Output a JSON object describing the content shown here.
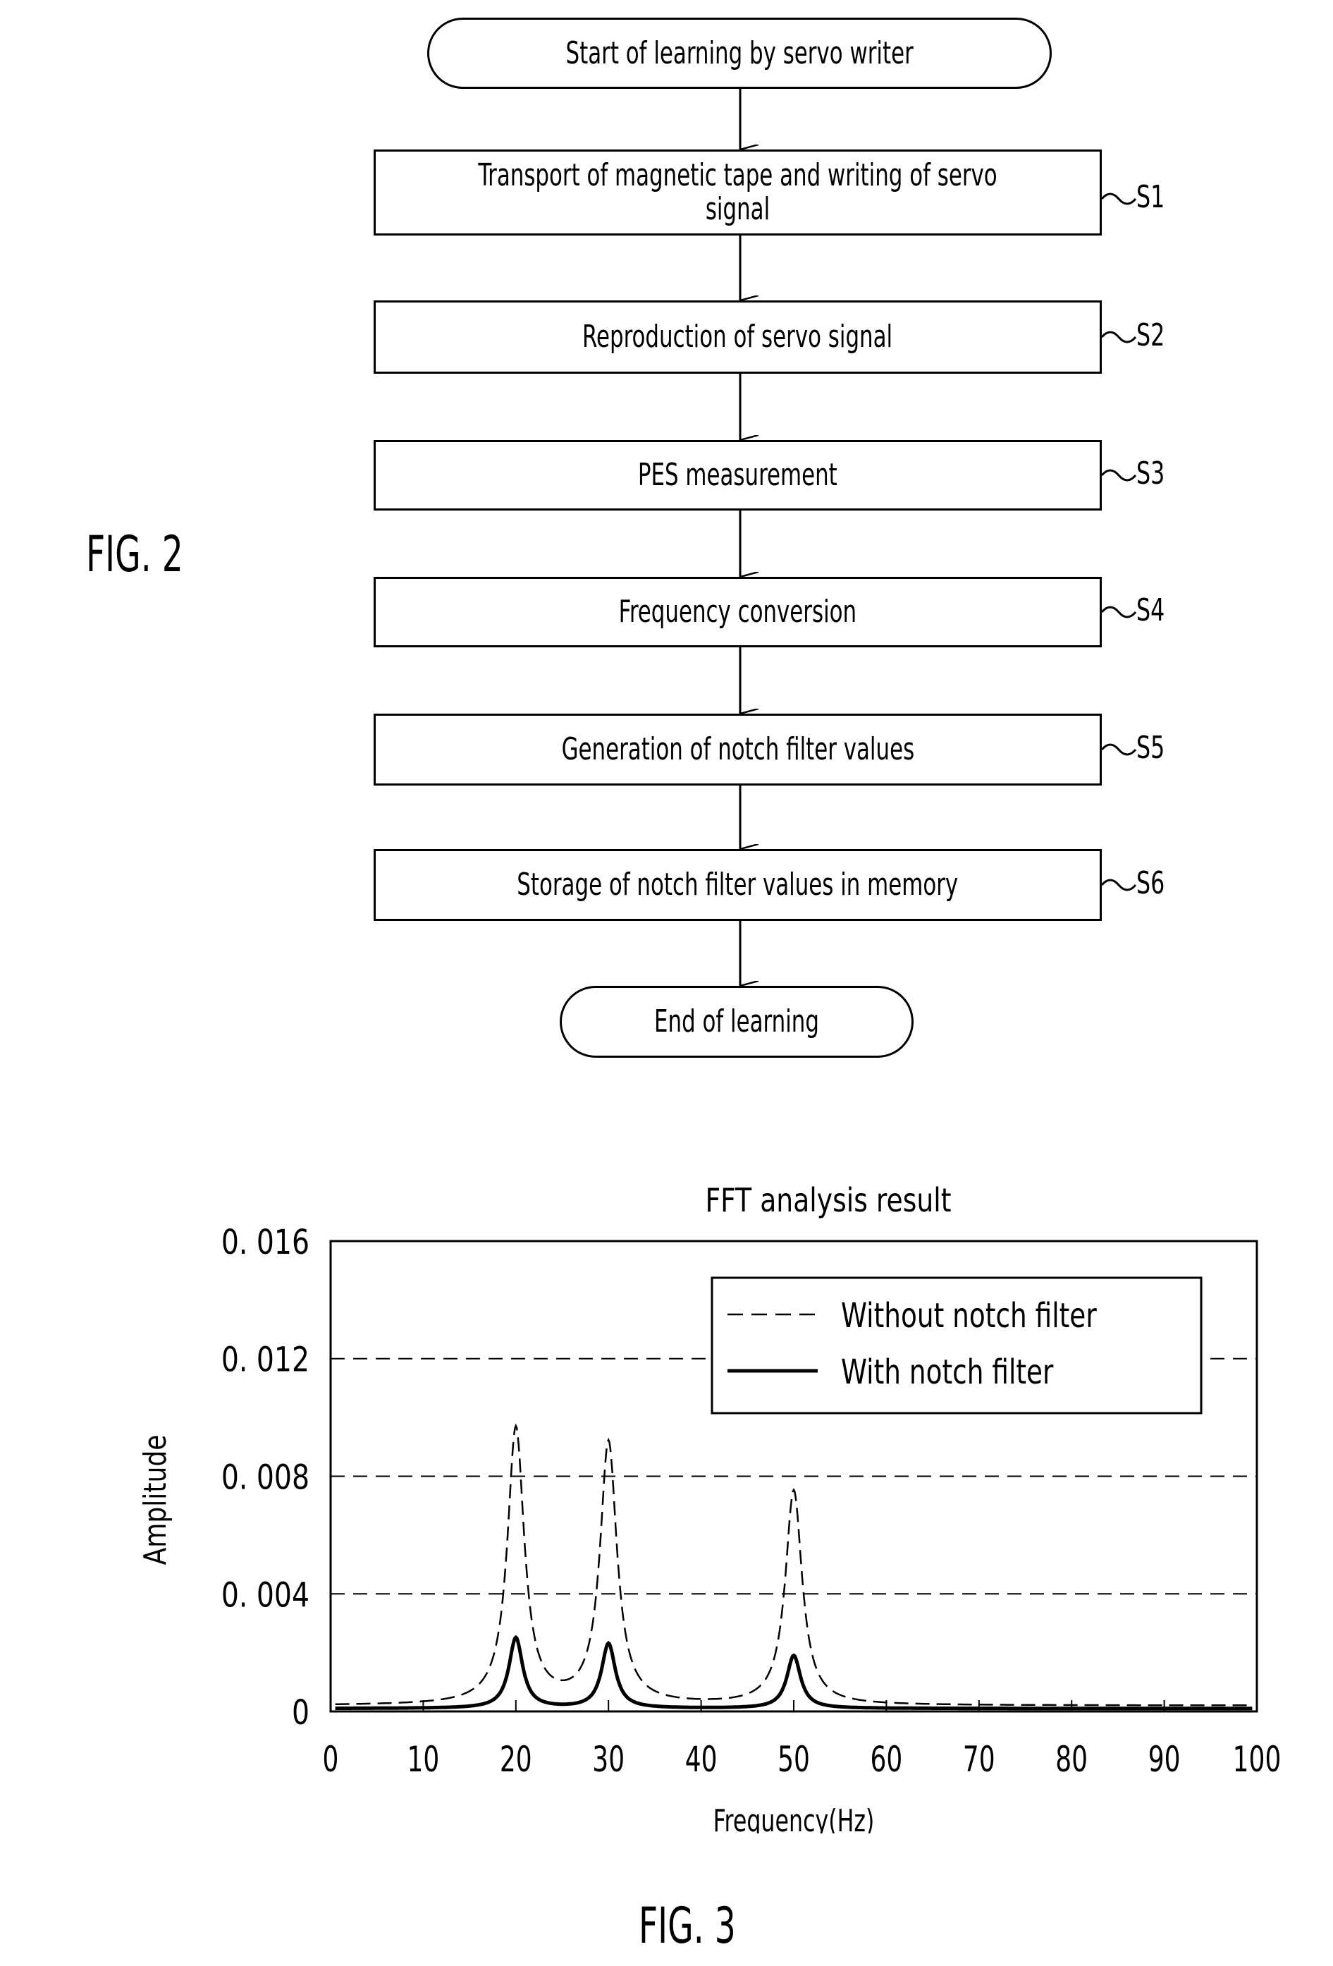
{
  "fig2": {
    "label": "FIG. 2",
    "start": "Start of learning by servo writer",
    "end": "End of learning",
    "steps": [
      {
        "id": "S1",
        "text": "Transport of magnetic tape and writing of servo signal"
      },
      {
        "id": "S2",
        "text": "Reproduction of servo signal"
      },
      {
        "id": "S3",
        "text": "PES measurement"
      },
      {
        "id": "S4",
        "text": "Frequency conversion"
      },
      {
        "id": "S5",
        "text": "Generation of notch filter values"
      },
      {
        "id": "S6",
        "text": "Storage of notch filter values in memory"
      }
    ]
  },
  "fig3": {
    "label": "FIG. 3"
  },
  "chart_data": {
    "type": "line",
    "title": "FFT analysis result",
    "xlabel": "Frequency(Hz)",
    "ylabel": "Amplitude",
    "xlim": [
      0,
      100
    ],
    "ylim": [
      0,
      0.016
    ],
    "xticks": [
      0,
      10,
      20,
      30,
      40,
      50,
      60,
      70,
      80,
      90,
      100
    ],
    "yticks": [
      0,
      0.004,
      0.008,
      0.012,
      0.016
    ],
    "ytick_labels": [
      "0",
      "0. 004",
      "0. 008",
      "0. 012",
      "0. 016"
    ],
    "grid": "horizontal dashed",
    "legend_position": "top-right",
    "series": [
      {
        "name": "Without notch filter",
        "style": "dashed",
        "peaks": [
          {
            "x": 20,
            "y": 0.0096
          },
          {
            "x": 30,
            "y": 0.0091
          },
          {
            "x": 50,
            "y": 0.0075
          }
        ],
        "baseline": 0.0002
      },
      {
        "name": "With notch filter",
        "style": "solid",
        "peaks": [
          {
            "x": 20,
            "y": 0.0025
          },
          {
            "x": 30,
            "y": 0.0023
          },
          {
            "x": 50,
            "y": 0.0019
          }
        ],
        "baseline": 0.0001
      }
    ]
  }
}
